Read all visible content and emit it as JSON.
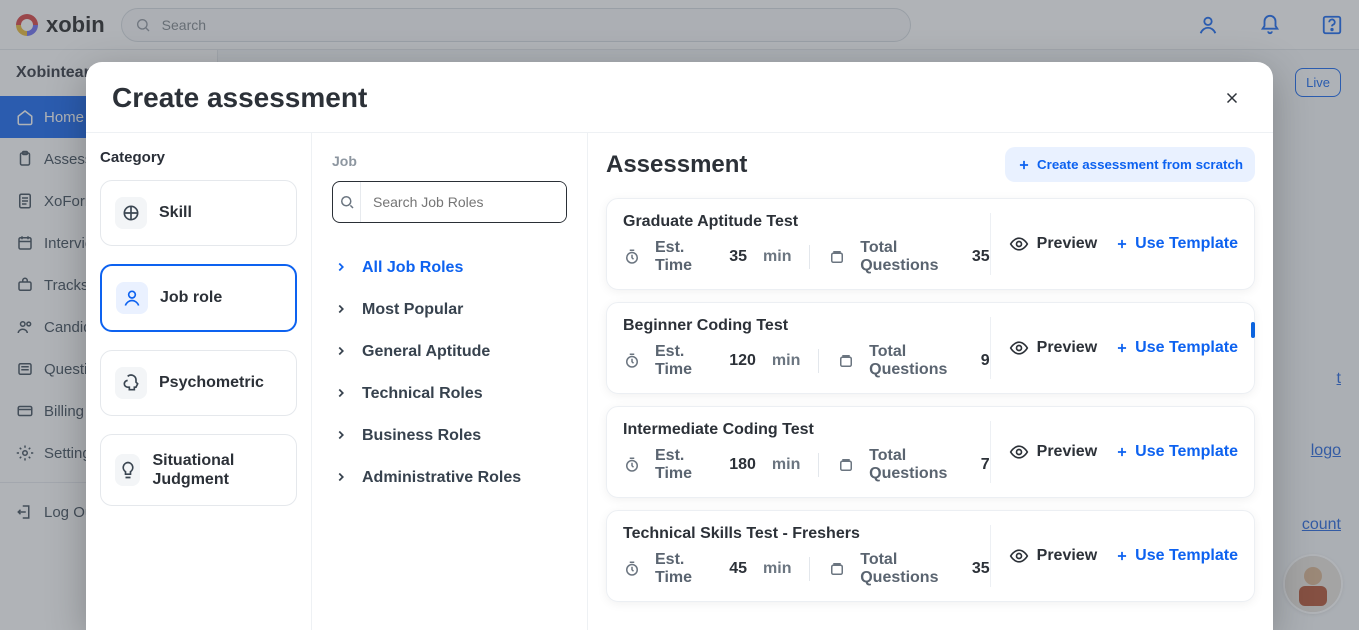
{
  "topbar": {
    "brand": "xobin",
    "search_placeholder": "Search"
  },
  "sidebar": {
    "team": "Xobinteam",
    "items": [
      {
        "label": "Home"
      },
      {
        "label": "Assessments"
      },
      {
        "label": "XoForms"
      },
      {
        "label": "Interviews"
      },
      {
        "label": "Tracks"
      },
      {
        "label": "Candidates"
      },
      {
        "label": "Questions"
      },
      {
        "label": "Billing"
      },
      {
        "label": "Settings"
      }
    ],
    "logout": "Log Out"
  },
  "right_panel": {
    "live_badge": "Live",
    "links": {
      "a": "t",
      "b": "logo",
      "c": "count"
    }
  },
  "modal": {
    "title": "Create assessment",
    "category_title": "Category",
    "categories": [
      {
        "label": "Skill",
        "active": false
      },
      {
        "label": "Job role",
        "active": true
      },
      {
        "label": "Psychometric",
        "active": false
      },
      {
        "label": "Situational Judgment",
        "active": false
      }
    ],
    "job": {
      "title": "Job",
      "search_placeholder": "Search Job Roles",
      "items": [
        {
          "label": "All Job Roles",
          "active": true
        },
        {
          "label": "Most Popular"
        },
        {
          "label": "General Aptitude"
        },
        {
          "label": "Technical Roles"
        },
        {
          "label": "Business Roles"
        },
        {
          "label": "Administrative Roles"
        }
      ]
    },
    "assessment": {
      "title": "Assessment",
      "create_label": "Create assessment from scratch",
      "labels": {
        "est_time": "Est. Time",
        "time_unit": "min",
        "total_q": "Total Questions",
        "preview": "Preview",
        "use": "Use Template"
      },
      "cards": [
        {
          "name": "Graduate Aptitude Test",
          "time": "35",
          "questions": "35"
        },
        {
          "name": "Beginner Coding Test",
          "time": "120",
          "questions": "9"
        },
        {
          "name": "Intermediate Coding Test",
          "time": "180",
          "questions": "7"
        },
        {
          "name": "Technical Skills Test - Freshers",
          "time": "45",
          "questions": "35"
        }
      ]
    }
  }
}
